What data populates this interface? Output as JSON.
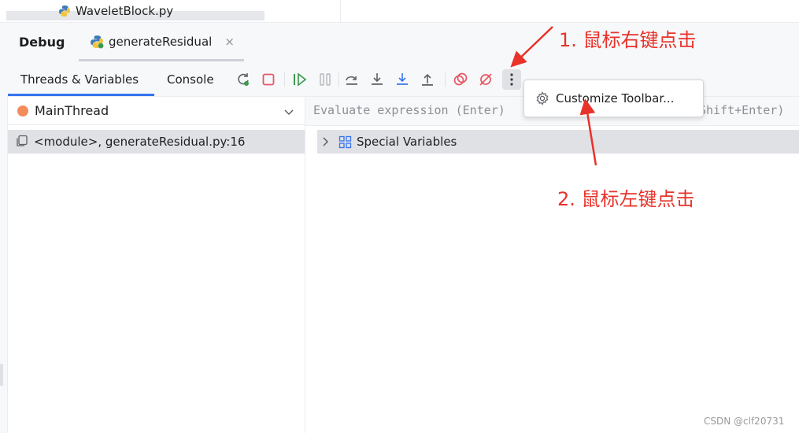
{
  "file_tab": {
    "label": "WaveletBlock.py",
    "icon": "python-icon"
  },
  "debug_panel": {
    "title": "Debug",
    "session_tab": {
      "label": "generateResidual",
      "close": "×",
      "icon": "python-icon"
    }
  },
  "toolbar": {
    "tabs": [
      {
        "label": "Threads & Variables",
        "active": true
      },
      {
        "label": "Console",
        "active": false
      }
    ],
    "buttons": [
      "rerun-icon",
      "stop-icon",
      "resume-icon",
      "pause-icon",
      "step-over-icon",
      "step-into-icon",
      "step-into-my-code-icon",
      "step-out-icon",
      "view-breakpoints-icon",
      "mute-breakpoints-icon",
      "more-icon"
    ],
    "more_label": "⋮"
  },
  "threads": {
    "selected": "MainThread",
    "frames": [
      {
        "label": "<module>, generateResidual.py:16"
      }
    ]
  },
  "variables": {
    "evaluate_placeholder": "Evaluate expression (Enter)",
    "evaluate_hint_tail": "Shift+Enter)",
    "items": [
      {
        "label": "Special Variables"
      }
    ]
  },
  "context_menu": {
    "items": [
      {
        "label": "Customize Toolbar...",
        "icon": "gear-icon"
      }
    ]
  },
  "annotations": {
    "step1": "1. 鼠标右键点击",
    "step2": "2. 鼠标左键点击",
    "color": "#e8322a"
  },
  "watermark": "CSDN @clf20731",
  "colors": {
    "accent": "#3574f0",
    "thread_dot": "#f28c5a",
    "resume_green": "#3d9a50",
    "stop_red": "#e55765"
  }
}
